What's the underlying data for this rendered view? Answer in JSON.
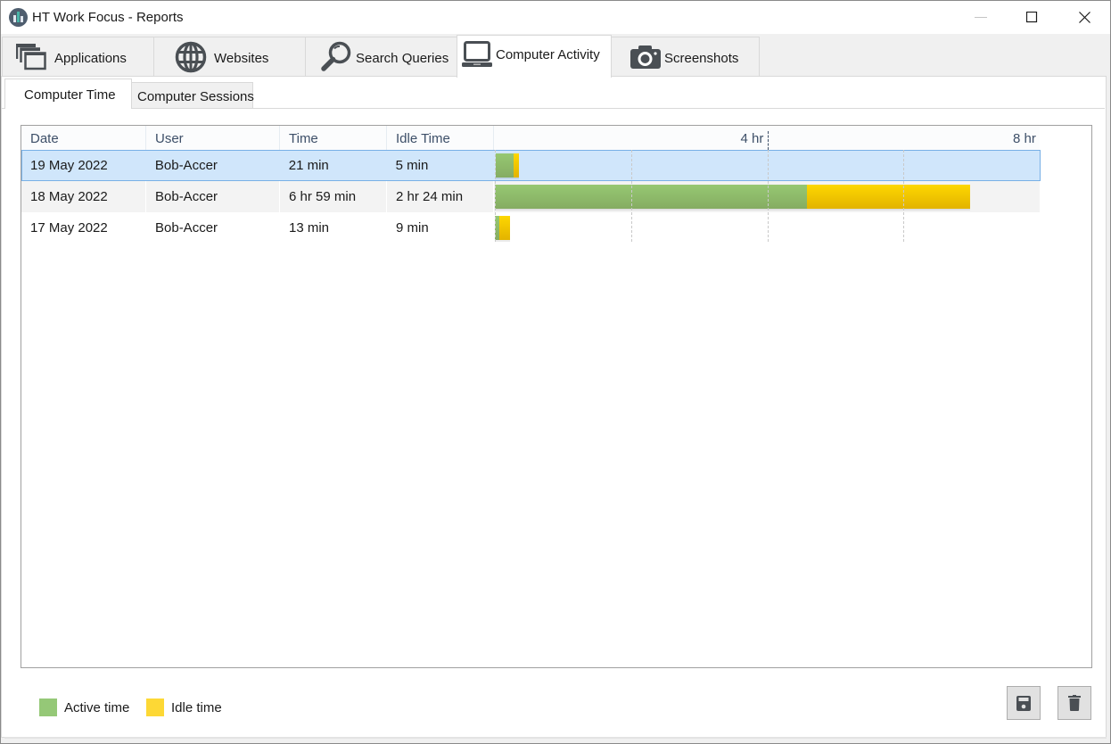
{
  "window": {
    "title": "HT Work Focus - Reports",
    "app_icon": "bar-chart-circle-icon",
    "controls": [
      "minimize-icon",
      "maximize-icon",
      "close-icon"
    ]
  },
  "main_tabs": [
    {
      "label": "Applications",
      "icon": "applications-icon",
      "active": false
    },
    {
      "label": "Websites",
      "icon": "globe-icon",
      "active": false
    },
    {
      "label": "Search Queries",
      "icon": "search-icon",
      "active": false
    },
    {
      "label": "Computer Activity",
      "icon": "laptop-icon",
      "active": true
    },
    {
      "label": "Screenshots",
      "icon": "camera-icon",
      "active": false
    }
  ],
  "sub_tabs": [
    {
      "label": "Computer Time",
      "active": true
    },
    {
      "label": "Computer Sessions",
      "active": false
    }
  ],
  "grid": {
    "columns": [
      "Date",
      "User",
      "Time",
      "Idle Time"
    ],
    "axis": {
      "max_hours": 8,
      "ticks": [
        {
          "hours": 0,
          "label": ""
        },
        {
          "hours": 2,
          "label": ""
        },
        {
          "hours": 4,
          "label": "4 hr"
        },
        {
          "hours": 6,
          "label": ""
        },
        {
          "hours": 8,
          "label": "8 hr"
        }
      ]
    },
    "rows": [
      {
        "date": "19 May 2022",
        "user": "Bob-Accer",
        "time": "21 min",
        "idle_time": "5 min",
        "active_minutes": 16,
        "idle_minutes": 5,
        "selected": true
      },
      {
        "date": "18 May 2022",
        "user": "Bob-Accer",
        "time": "6 hr 59 min",
        "idle_time": "2 hr 24 min",
        "active_minutes": 275,
        "idle_minutes": 144,
        "selected": false
      },
      {
        "date": "17 May 2022",
        "user": "Bob-Accer",
        "time": "13 min",
        "idle_time": "9 min",
        "active_minutes": 4,
        "idle_minutes": 9,
        "selected": false
      }
    ]
  },
  "legend": [
    {
      "label": "Active time",
      "color": "#95c877"
    },
    {
      "label": "Idle time",
      "color": "#fdd835"
    }
  ],
  "actions": {
    "save": "save-icon",
    "delete": "trash-icon"
  },
  "chart_data": {
    "type": "bar",
    "orientation": "horizontal-stacked",
    "categories": [
      "19 May 2022",
      "18 May 2022",
      "17 May 2022"
    ],
    "series": [
      {
        "name": "Active time",
        "values_minutes": [
          16,
          275,
          4
        ]
      },
      {
        "name": "Idle time",
        "values_minutes": [
          5,
          144,
          9
        ]
      }
    ],
    "xlabel": "",
    "ylabel": "",
    "xlim_hours": [
      0,
      8
    ],
    "tick_labels": [
      "4 hr",
      "8 hr"
    ],
    "grid": true,
    "legend": "bottom-left"
  }
}
